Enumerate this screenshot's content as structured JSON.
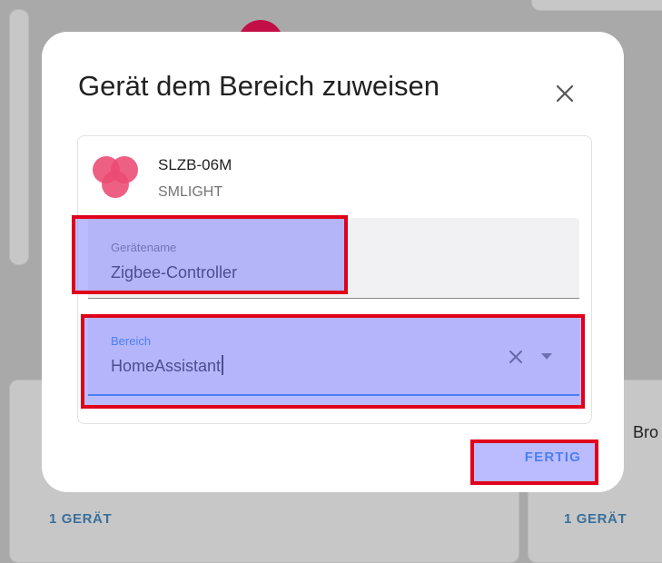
{
  "background": {
    "footer_left": "1 GERÄT",
    "footer_right": "1 GERÄT",
    "partial_text_right": "Bro"
  },
  "dialog": {
    "title": "Gerät dem Bereich zuweisen",
    "close_icon": "close-icon",
    "device": {
      "name": "SLZB-06M",
      "manufacturer": "SMLIGHT",
      "logo_icon": "smlight-logo-icon",
      "logo_color": "#e8436b"
    },
    "device_name_field": {
      "label": "Gerätename",
      "value": "Zigbee-Controller"
    },
    "area_field": {
      "label": "Bereich",
      "value": "HomeAssistant",
      "clear_icon": "close-icon",
      "dropdown_icon": "caret-down-icon"
    },
    "done_button": {
      "label": "FERTIG"
    }
  },
  "colors": {
    "primary": "#1e88e5",
    "highlight_border": "#e0001a",
    "highlight_fill": "#7878ff"
  }
}
